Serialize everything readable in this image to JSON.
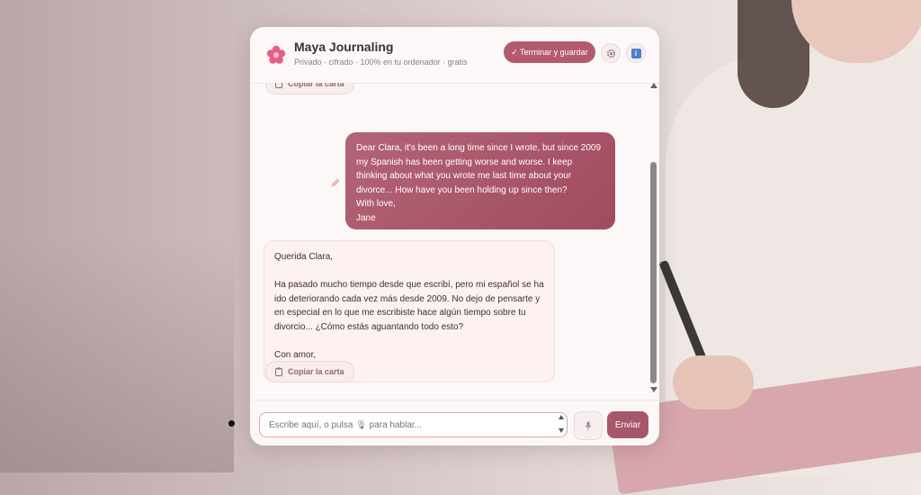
{
  "app": {
    "title": "Maya Journaling",
    "subtitle": "Privado · cifrado · 100% en tu ordenador · gratis"
  },
  "header": {
    "finish_label": "✓ Terminar y guardar",
    "gear_icon": "gear-icon",
    "info_icon": "info-icon"
  },
  "chat": {
    "copy_label": "Copiar la carta",
    "user_message": "Dear Clara, it's been a long time since I wrote, but since 2009 my Spanish has been getting worse and worse. I keep thinking about what you wrote me last time about your divorce... How have you been holding up since then?\nWith love,\nJane",
    "bot_message": "Querida Clara,\n\nHa pasado mucho tiempo desde que escribí, pero mi español se ha ido deteriorando cada vez más desde 2009. No dejo de pensarte y en especial en lo que me escribiste hace algún tiempo sobre tu divorcio... ¿Cómo estás aguantando todo esto?\n\nCon amor,\nJane"
  },
  "composer": {
    "placeholder": "Escribe aquí, o pulsa 🎙 para hablar...",
    "value": "",
    "send_label": "Enviar"
  },
  "colors": {
    "accent": "#b35a6e",
    "user_bubble": "#a94f65",
    "bot_bubble": "#fdf1f2"
  }
}
